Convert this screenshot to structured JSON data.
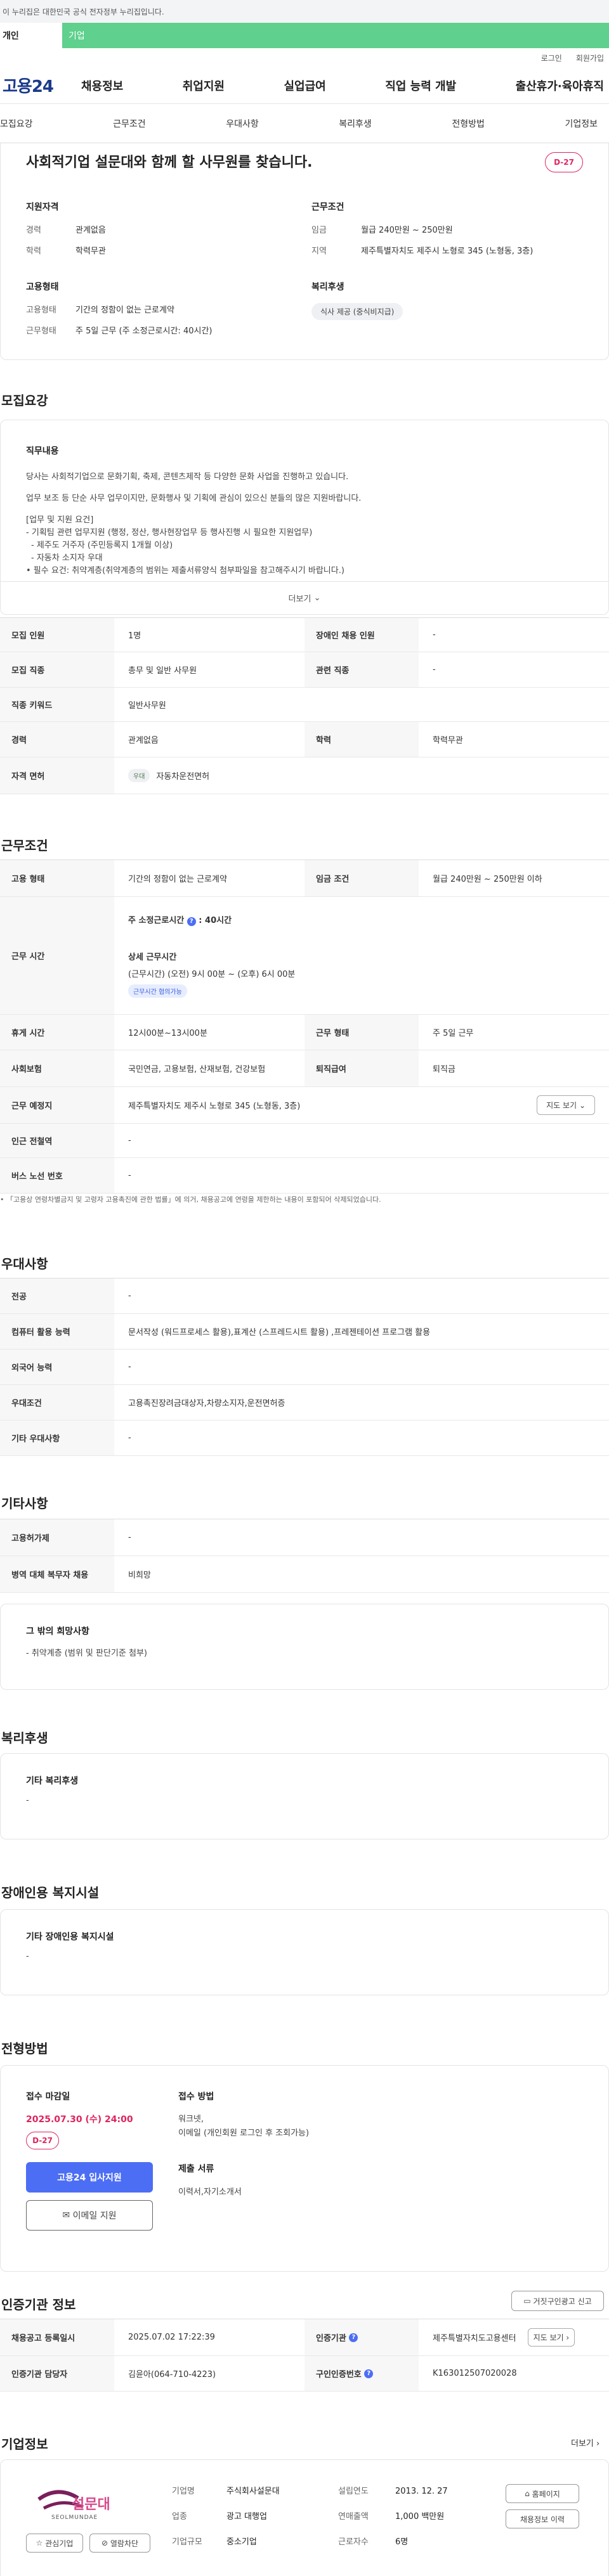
{
  "topbar": {
    "text": "이 누리집은 대한민국 공식 전자정부 누리집입니다."
  },
  "gov_tabs": {
    "individual": "개인",
    "business": "기업"
  },
  "util": {
    "login": "로그인",
    "join": "회원가입"
  },
  "gnb": {
    "logo": "고용24",
    "items": [
      "채용정보",
      "취업지원",
      "실업급여",
      "직업 능력 개발",
      "출산휴가·육아휴직"
    ]
  },
  "subtabs": [
    "모집요강",
    "근무조건",
    "우대사항",
    "복리후생",
    "전형방법",
    "기업정보"
  ],
  "summary": {
    "title": "사회적기업 설문대와 함께 할 사무원를 찾습니다.",
    "dday": "D-27",
    "qual_head": "지원자격",
    "qual": [
      {
        "k": "경력",
        "v": "관계없음"
      },
      {
        "k": "학력",
        "v": "학력무관"
      }
    ],
    "cond_head": "근무조건",
    "cond": [
      {
        "k": "임금",
        "v": "월급 240만원 ~ 250만원"
      },
      {
        "k": "지역",
        "v": "제주특별자치도 제주시 노형로 345 (노형동, 3층)"
      }
    ],
    "emp_head": "고용형태",
    "emp": [
      {
        "k": "고용형태",
        "v": "기간의 정함이 없는 근로계약"
      },
      {
        "k": "근무형태",
        "v": "주 5일 근무 (주 소정근로시간: 40시간)"
      }
    ],
    "welfare_head": "복리후생",
    "welfare_chip": "식사 제공 (중식비지급)"
  },
  "recruit": {
    "heading": "모집요강",
    "duty_label": "직무내용",
    "duty_lines": [
      "당사는 사회적기업으로 문화기획, 축제, 콘텐츠제작 등 다양한 문화 사업을 진행하고 있습니다.",
      "",
      "업무 보조 등 단순 사무 업무이지만, 문화행사 및 기획에 관심이 있으신 분들의 많은 지원바랍니다.",
      "",
      "[업무 및 지원 요건]",
      "- 기획팀 관련 업무지원 (행정, 정산, 행사현장업무 등 행사진행 시 필요한 지원업무)",
      "  - 제주도 거주자 (주민등록지 1개월 이상)",
      "  - 자동차 소지자 우대",
      "• 필수 요건: 취약계층(취약계층의 범위는 제출서류양식 첨부파일을 참고해주시기 바랍니다.)"
    ],
    "more": "더보기",
    "rows": [
      {
        "k1": "모집 인원",
        "v1": "1명",
        "k2": "장애인 채용 인원",
        "v2": "-"
      },
      {
        "k1": "모집 직종",
        "v1": "총무 및 일반 사무원",
        "k2": "관련 직종",
        "v2": "-"
      },
      {
        "k1": "직종 키워드",
        "v1": "일반사무원"
      },
      {
        "k1": "경력",
        "v1": "관계없음",
        "k2": "학력",
        "v2": "학력무관"
      },
      {
        "k1": "자격 면허",
        "badge": "우대",
        "v1": "자동차운전면허"
      }
    ]
  },
  "conditions": {
    "heading": "근무조건",
    "emp_k": "고용 형태",
    "emp_v": "기간의 정함이 없는 근로계약",
    "wage_k": "임금 조건",
    "wage_v": "월급 240만원 ~ 250만원 이하",
    "hours_k": "근무 시간",
    "hours_week": "주 소정근로시간",
    "hours_week_val": "40시간",
    "hours_detail_head": "상세 근무시간",
    "hours_detail": "(근무시간) (오전) 9시 00분 ~ (오후) 6시 00분",
    "hours_badge": "근무시간 협의가능",
    "break_k": "휴게 시간",
    "break_v": "12시00분~13시00분",
    "shape_k": "근무 형태",
    "shape_v": "주 5일 근무",
    "ins_k": "사회보험",
    "ins_v": "국민연금, 고용보험, 산재보험, 건강보험",
    "sev_k": "퇴직급여",
    "sev_v": "퇴직금",
    "place_k": "근무 예정지",
    "place_v": "제주특별자치도 제주시 노형로 345 (노형동, 3층)",
    "map_btn": "지도 보기",
    "station_k": "인근 전철역",
    "station_v": "-",
    "bus_k": "버스 노선 번호",
    "bus_v": "-",
    "note": "「고용상 연령차별금지 및 고령자 고용촉진에 관한 법률」에 의거, 채용공고에 연령을 제한하는 내용이 포함되어 삭제되었습니다."
  },
  "pref": {
    "heading": "우대사항",
    "rows": [
      {
        "k": "전공",
        "v": "-"
      },
      {
        "k": "컴퓨터 활용 능력",
        "v": "문서작성 (워드프로세스 활용),표계산 (스프레드시트 활용) ,프레젠테이션 프로그램 활용"
      },
      {
        "k": "외국어 능력",
        "v": "-"
      },
      {
        "k": "우대조건",
        "v": "고용촉진장려금대상자,차량소지자,운전면허증"
      },
      {
        "k": "기타 우대사항",
        "v": "-"
      }
    ]
  },
  "etc": {
    "heading": "기타사항",
    "rows": [
      {
        "k": "고용허가제",
        "v": "-"
      },
      {
        "k": "병역 대체 복무자 채용",
        "v": "비희망"
      }
    ],
    "box_title": "그 밖의 희망사항",
    "box_text": "- 취약계층 (범위 및 판단기준 첨부)"
  },
  "welfare": {
    "heading": "복리후생",
    "box_title": "기타 복리후생",
    "box_text": "-"
  },
  "disabled": {
    "heading": "장애인용 복지시설",
    "box_title": "기타 장애인용 복지시설",
    "box_text": "-"
  },
  "apply": {
    "heading": "전형방법",
    "deadline_head": "접수 마감일",
    "deadline": "2025.07.30 (수) 24:00",
    "dday": "D-27",
    "btn_apply": "고용24 입사지원",
    "btn_email": "이메일 지원",
    "method_head": "접수 방법",
    "method_lines": [
      "워크넷,",
      "이메일 (개인회원 로그인 후 조회가능)"
    ],
    "docs_head": "제출 서류",
    "docs": "이력서,자기소개서"
  },
  "agency": {
    "heading": "인증기관 정보",
    "report_btn": "거짓구인광고 신고",
    "reg_k": "채용공고 등록일시",
    "reg_v": "2025.07.02 17:22:39",
    "org_k": "인증기관",
    "org_v": "제주특별자치도고용센터",
    "map_btn": "지도 보기",
    "mgr_k": "인증기관 담당자",
    "mgr_v": "김윤아(064-710-4223)",
    "num_k": "구인인증번호",
    "num_v": "K163012507020028"
  },
  "company": {
    "heading": "기업정보",
    "more": "더보기",
    "logo_text": "설문대",
    "logo_sub": "SEOLMUNDAE",
    "fav_btn": "관심기업",
    "block_btn": "열람차단",
    "fields": [
      {
        "k": "기업명",
        "v": "주식회사설문대"
      },
      {
        "k": "업종",
        "v": "광고 대행업"
      },
      {
        "k": "기업규모",
        "v": "중소기업"
      }
    ],
    "fields2": [
      {
        "k": "설립연도",
        "v": "2013. 12. 27"
      },
      {
        "k": "연매출액",
        "v": "1,000 백만원"
      },
      {
        "k": "근로자수",
        "v": "6명"
      }
    ],
    "homepage_btn": "홈페이지",
    "recruit_btn": "채용정보 이력"
  }
}
